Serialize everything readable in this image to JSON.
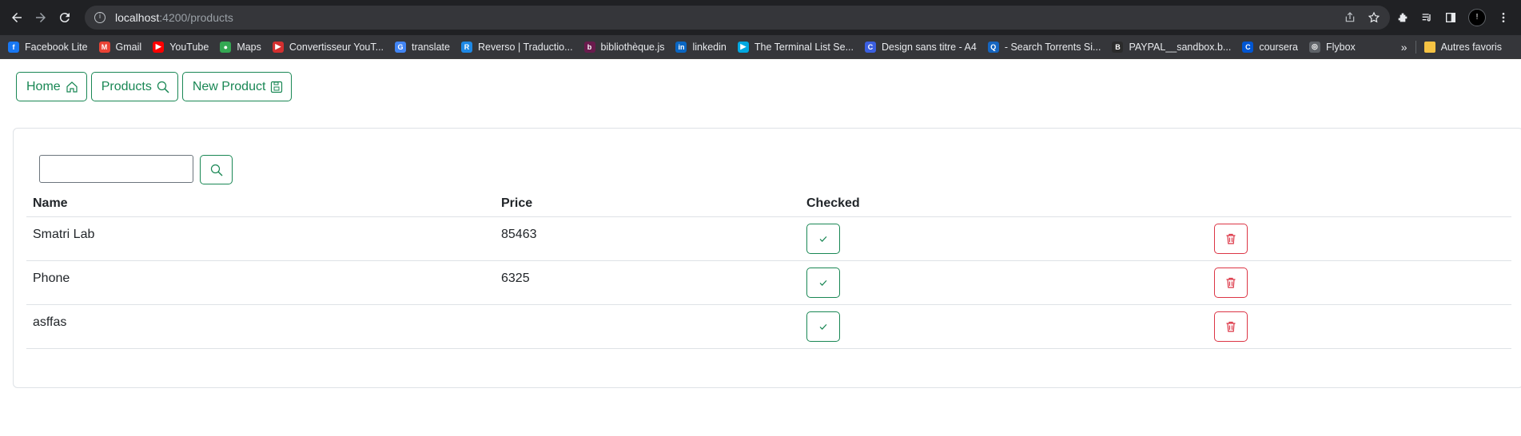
{
  "browser": {
    "url_host": "localhost",
    "url_path": ":4200/products",
    "profile_initial": "!"
  },
  "bookmarks": [
    {
      "label": "Facebook Lite",
      "icon": "facebook-icon",
      "color": "#1877f2",
      "glyph": "f"
    },
    {
      "label": "Gmail",
      "icon": "gmail-icon",
      "color": "#ea4335",
      "glyph": "M"
    },
    {
      "label": "YouTube",
      "icon": "youtube-icon",
      "color": "#ff0000",
      "glyph": "▶"
    },
    {
      "label": "Maps",
      "icon": "maps-icon",
      "color": "#34a853",
      "glyph": "●"
    },
    {
      "label": "Convertisseur YouT...",
      "icon": "converter-icon",
      "color": "#d32f2f",
      "glyph": "▶"
    },
    {
      "label": "translate",
      "icon": "translate-icon",
      "color": "#4285f4",
      "glyph": "G"
    },
    {
      "label": "Reverso | Traductio...",
      "icon": "reverso-icon",
      "color": "#1e88e5",
      "glyph": "R"
    },
    {
      "label": "bibliothèque.js",
      "icon": "library-icon",
      "color": "#6a1b4d",
      "glyph": "b"
    },
    {
      "label": "linkedin",
      "icon": "linkedin-icon",
      "color": "#0a66c2",
      "glyph": "in"
    },
    {
      "label": "The Terminal List Se...",
      "icon": "prime-icon",
      "color": "#00a8e1",
      "glyph": "▶"
    },
    {
      "label": "Design sans titre - A4",
      "icon": "canva-icon",
      "color": "#3b5fe0",
      "glyph": "C"
    },
    {
      "label": "- Search Torrents Si...",
      "icon": "torrents-icon",
      "color": "#1565c0",
      "glyph": "Q"
    },
    {
      "label": "PAYPAL__sandbox.b...",
      "icon": "paypal-icon",
      "color": "#2b2b2b",
      "glyph": "B"
    },
    {
      "label": "coursera",
      "icon": "coursera-icon",
      "color": "#0056d2",
      "glyph": "C"
    },
    {
      "label": "Flybox",
      "icon": "globe-icon",
      "color": "#5f6368",
      "glyph": "◎"
    }
  ],
  "bookmarks_more": "»",
  "bookmarks_folder": "Autres favoris",
  "nav": {
    "home_label": "Home",
    "products_label": "Products",
    "new_product_label": "New Product"
  },
  "search": {
    "value": "",
    "placeholder": ""
  },
  "table": {
    "headers": {
      "name": "Name",
      "price": "Price",
      "checked": "Checked"
    },
    "rows": [
      {
        "name": "Smatri Lab",
        "price": "85463"
      },
      {
        "name": "Phone",
        "price": "6325"
      },
      {
        "name": "asffas",
        "price": ""
      }
    ]
  },
  "colors": {
    "success": "#198754",
    "danger": "#dc3545",
    "chrome_dark": "#202124"
  }
}
